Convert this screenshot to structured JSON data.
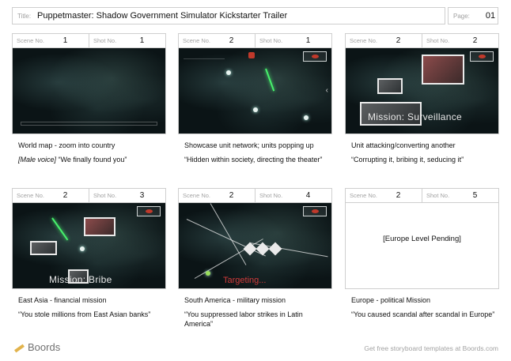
{
  "header": {
    "title_label": "Title:",
    "title": "Puppetmaster: Shadow Government Simulator Kickstarter Trailer",
    "page_label": "Page:",
    "page": "01"
  },
  "labels": {
    "scene": "Scene No.",
    "shot": "Shot No."
  },
  "panels": [
    {
      "scene": "1",
      "shot": "1",
      "lines": [
        "World map - zoom into country",
        "[Male voice]",
        "“We finally found you”"
      ]
    },
    {
      "scene": "2",
      "shot": "1",
      "lines": [
        "Showcase unit network; units popping up",
        "“Hidden within society, directing the theater”"
      ]
    },
    {
      "scene": "2",
      "shot": "2",
      "lines": [
        "Unit attacking/converting another",
        "“Corrupting it, bribing it, seducing it”"
      ],
      "overlay": "Mission: Surveillance"
    },
    {
      "scene": "2",
      "shot": "3",
      "lines": [
        "East Asia -  financial mission",
        "“You stole millions from East Asian banks”"
      ],
      "overlay": "Mission: Bribe"
    },
    {
      "scene": "2",
      "shot": "4",
      "lines": [
        "South America - military mission",
        "“You suppressed labor strikes in Latin America”"
      ],
      "overlay": "Targeting..."
    },
    {
      "scene": "2",
      "shot": "5",
      "lines": [
        "Europe - political Mission",
        "“You caused scandal after scandal  in Europe”"
      ],
      "overlay": "[Europe Level Pending]"
    }
  ],
  "footer": {
    "brand": "Boords",
    "note": "Get free storyboard templates at Boords.com"
  },
  "icons": [
    "pencil-logo-icon",
    "eye-icon",
    "network-node-icon",
    "chevron-right-icon"
  ],
  "colors": {
    "frame_border": "#cfcfcf",
    "targeting_red": "#d13a3a",
    "network_green": "#47f06c",
    "logo_yellow": "#e2b34c"
  }
}
